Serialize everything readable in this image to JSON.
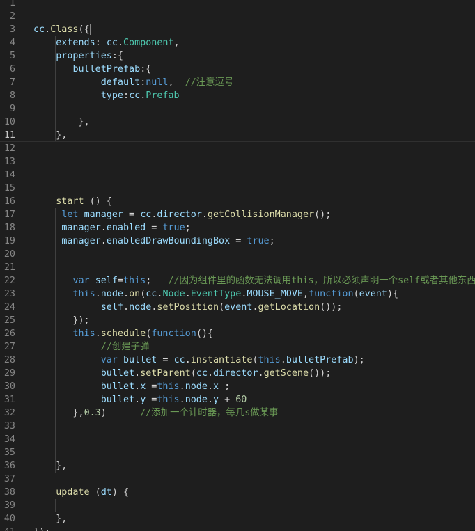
{
  "editor": {
    "active_line": 11,
    "colors": {
      "background": "#1e1e1e",
      "plain": "#d4d4d4",
      "keyword": "#569cd6",
      "control": "#c586c0",
      "variable": "#9cdcfe",
      "function": "#dcdcaa",
      "type": "#4ec9b0",
      "number": "#b5cea8",
      "comment": "#6a9955",
      "line_number": "#858585"
    },
    "lines": [
      {
        "n": "1",
        "tokens": []
      },
      {
        "n": "2",
        "tokens": []
      },
      {
        "n": "3",
        "tokens": [
          [
            "v",
            "cc"
          ],
          [
            "p",
            "."
          ],
          [
            "f",
            "Class"
          ],
          [
            "p",
            "("
          ],
          [
            "b",
            "{"
          ]
        ]
      },
      {
        "n": "4",
        "tokens": [
          [
            "p",
            "    "
          ],
          [
            "v",
            "extends"
          ],
          [
            "p",
            ": "
          ],
          [
            "v",
            "cc"
          ],
          [
            "p",
            "."
          ],
          [
            "t",
            "Component"
          ],
          [
            "p",
            ","
          ]
        ]
      },
      {
        "n": "5",
        "tokens": [
          [
            "p",
            "    "
          ],
          [
            "v",
            "properties"
          ],
          [
            "p",
            ":{"
          ]
        ]
      },
      {
        "n": "6",
        "tokens": [
          [
            "p",
            "       "
          ],
          [
            "v",
            "bulletPrefab"
          ],
          [
            "p",
            ":{"
          ]
        ]
      },
      {
        "n": "7",
        "tokens": [
          [
            "p",
            "            "
          ],
          [
            "v",
            "default"
          ],
          [
            "p",
            ":"
          ],
          [
            "k",
            "null"
          ],
          [
            "p",
            ",  "
          ],
          [
            "c",
            "//注意逗号"
          ]
        ]
      },
      {
        "n": "8",
        "tokens": [
          [
            "p",
            "            "
          ],
          [
            "v",
            "type"
          ],
          [
            "p",
            ":"
          ],
          [
            "v",
            "cc"
          ],
          [
            "p",
            "."
          ],
          [
            "t",
            "Prefab"
          ]
        ]
      },
      {
        "n": "9",
        "tokens": []
      },
      {
        "n": "10",
        "tokens": [
          [
            "p",
            "        },"
          ]
        ]
      },
      {
        "n": "11",
        "tokens": [
          [
            "p",
            "    },"
          ]
        ]
      },
      {
        "n": "12",
        "tokens": []
      },
      {
        "n": "13",
        "tokens": []
      },
      {
        "n": "14",
        "tokens": []
      },
      {
        "n": "15",
        "tokens": []
      },
      {
        "n": "16",
        "tokens": [
          [
            "p",
            "    "
          ],
          [
            "f",
            "start"
          ],
          [
            "p",
            " () {"
          ]
        ]
      },
      {
        "n": "17",
        "tokens": [
          [
            "p",
            "     "
          ],
          [
            "k",
            "let"
          ],
          [
            "p",
            " "
          ],
          [
            "v",
            "manager"
          ],
          [
            "p",
            " = "
          ],
          [
            "v",
            "cc"
          ],
          [
            "p",
            "."
          ],
          [
            "v",
            "director"
          ],
          [
            "p",
            "."
          ],
          [
            "f",
            "getCollisionManager"
          ],
          [
            "p",
            "();"
          ]
        ]
      },
      {
        "n": "18",
        "tokens": [
          [
            "p",
            "     "
          ],
          [
            "v",
            "manager"
          ],
          [
            "p",
            "."
          ],
          [
            "v",
            "enabled"
          ],
          [
            "p",
            " = "
          ],
          [
            "k",
            "true"
          ],
          [
            "p",
            ";"
          ]
        ]
      },
      {
        "n": "19",
        "tokens": [
          [
            "p",
            "     "
          ],
          [
            "v",
            "manager"
          ],
          [
            "p",
            "."
          ],
          [
            "v",
            "enabledDrawBoundingBox"
          ],
          [
            "p",
            " = "
          ],
          [
            "k",
            "true"
          ],
          [
            "p",
            ";"
          ]
        ]
      },
      {
        "n": "20",
        "tokens": []
      },
      {
        "n": "21",
        "tokens": []
      },
      {
        "n": "22",
        "tokens": [
          [
            "p",
            "       "
          ],
          [
            "k",
            "var"
          ],
          [
            "p",
            " "
          ],
          [
            "v",
            "self"
          ],
          [
            "p",
            "="
          ],
          [
            "k",
            "this"
          ],
          [
            "p",
            ";   "
          ],
          [
            "c",
            "//因为组件里的函数无法调用this，所以必须声明一个self或者其他东西"
          ]
        ]
      },
      {
        "n": "23",
        "tokens": [
          [
            "p",
            "       "
          ],
          [
            "k",
            "this"
          ],
          [
            "p",
            "."
          ],
          [
            "v",
            "node"
          ],
          [
            "p",
            "."
          ],
          [
            "f",
            "on"
          ],
          [
            "p",
            "("
          ],
          [
            "v",
            "cc"
          ],
          [
            "p",
            "."
          ],
          [
            "t",
            "Node"
          ],
          [
            "p",
            "."
          ],
          [
            "t",
            "EventType"
          ],
          [
            "p",
            "."
          ],
          [
            "v",
            "MOUSE_MOVE"
          ],
          [
            "p",
            ","
          ],
          [
            "k",
            "function"
          ],
          [
            "p",
            "("
          ],
          [
            "v",
            "event"
          ],
          [
            "p",
            "){"
          ]
        ]
      },
      {
        "n": "24",
        "tokens": [
          [
            "p",
            "            "
          ],
          [
            "v",
            "self"
          ],
          [
            "p",
            "."
          ],
          [
            "v",
            "node"
          ],
          [
            "p",
            "."
          ],
          [
            "f",
            "setPosition"
          ],
          [
            "p",
            "("
          ],
          [
            "v",
            "event"
          ],
          [
            "p",
            "."
          ],
          [
            "f",
            "getLocation"
          ],
          [
            "p",
            "());"
          ]
        ]
      },
      {
        "n": "25",
        "tokens": [
          [
            "p",
            "       });"
          ]
        ]
      },
      {
        "n": "26",
        "tokens": [
          [
            "p",
            "       "
          ],
          [
            "k",
            "this"
          ],
          [
            "p",
            "."
          ],
          [
            "f",
            "schedule"
          ],
          [
            "p",
            "("
          ],
          [
            "k",
            "function"
          ],
          [
            "p",
            "(){"
          ]
        ]
      },
      {
        "n": "27",
        "tokens": [
          [
            "p",
            "            "
          ],
          [
            "c",
            "//创建子弹"
          ]
        ]
      },
      {
        "n": "28",
        "tokens": [
          [
            "p",
            "            "
          ],
          [
            "k",
            "var"
          ],
          [
            "p",
            " "
          ],
          [
            "v",
            "bullet"
          ],
          [
            "p",
            " = "
          ],
          [
            "v",
            "cc"
          ],
          [
            "p",
            "."
          ],
          [
            "f",
            "instantiate"
          ],
          [
            "p",
            "("
          ],
          [
            "k",
            "this"
          ],
          [
            "p",
            "."
          ],
          [
            "v",
            "bulletPrefab"
          ],
          [
            "p",
            ");"
          ]
        ]
      },
      {
        "n": "29",
        "tokens": [
          [
            "p",
            "            "
          ],
          [
            "v",
            "bullet"
          ],
          [
            "p",
            "."
          ],
          [
            "f",
            "setParent"
          ],
          [
            "p",
            "("
          ],
          [
            "v",
            "cc"
          ],
          [
            "p",
            "."
          ],
          [
            "v",
            "director"
          ],
          [
            "p",
            "."
          ],
          [
            "f",
            "getScene"
          ],
          [
            "p",
            "());"
          ]
        ]
      },
      {
        "n": "30",
        "tokens": [
          [
            "p",
            "            "
          ],
          [
            "v",
            "bullet"
          ],
          [
            "p",
            "."
          ],
          [
            "v",
            "x"
          ],
          [
            "p",
            " ="
          ],
          [
            "k",
            "this"
          ],
          [
            "p",
            "."
          ],
          [
            "v",
            "node"
          ],
          [
            "p",
            "."
          ],
          [
            "v",
            "x"
          ],
          [
            "p",
            " ;"
          ]
        ]
      },
      {
        "n": "31",
        "tokens": [
          [
            "p",
            "            "
          ],
          [
            "v",
            "bullet"
          ],
          [
            "p",
            "."
          ],
          [
            "v",
            "y"
          ],
          [
            "p",
            " ="
          ],
          [
            "k",
            "this"
          ],
          [
            "p",
            "."
          ],
          [
            "v",
            "node"
          ],
          [
            "p",
            "."
          ],
          [
            "v",
            "y"
          ],
          [
            "p",
            " + "
          ],
          [
            "n",
            "60"
          ]
        ]
      },
      {
        "n": "32",
        "tokens": [
          [
            "p",
            "       },"
          ],
          [
            "n",
            "0.3"
          ],
          [
            "p",
            ")      "
          ],
          [
            "c",
            "//添加一个计时器，每几s做某事"
          ]
        ]
      },
      {
        "n": "33",
        "tokens": []
      },
      {
        "n": "34",
        "tokens": []
      },
      {
        "n": "35",
        "tokens": []
      },
      {
        "n": "36",
        "tokens": [
          [
            "p",
            "    },"
          ]
        ]
      },
      {
        "n": "37",
        "tokens": []
      },
      {
        "n": "38",
        "tokens": [
          [
            "p",
            "    "
          ],
          [
            "f",
            "update"
          ],
          [
            "p",
            " ("
          ],
          [
            "v",
            "dt"
          ],
          [
            "p",
            ") {"
          ]
        ]
      },
      {
        "n": "39",
        "tokens": []
      },
      {
        "n": "40",
        "tokens": [
          [
            "p",
            "    },"
          ]
        ]
      },
      {
        "n": "41",
        "tokens": [
          [
            "b",
            "}"
          ],
          [
            "p",
            ");"
          ]
        ]
      }
    ]
  }
}
